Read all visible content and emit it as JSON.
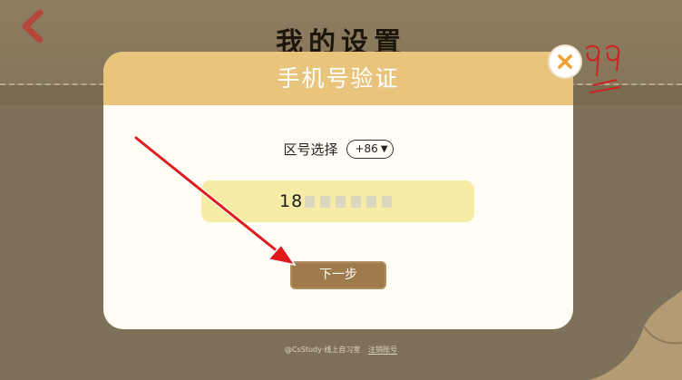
{
  "background": {
    "title": "我的设置",
    "back_icon": "chevron-left-icon",
    "footer_text": "@CsStudy·线上自习室",
    "footer_link": "注销账号"
  },
  "modal": {
    "title": "手机号验证",
    "region_label": "区号选择",
    "region_code": "+86",
    "phone_visible_prefix": "18",
    "next_button": "下一步",
    "close_icon": "close-icon"
  },
  "colors": {
    "header_gold": "#e8c47c",
    "field_yellow": "#f6eca6",
    "button_brown": "#9f7b4c",
    "annotation_red": "#e0191a"
  }
}
